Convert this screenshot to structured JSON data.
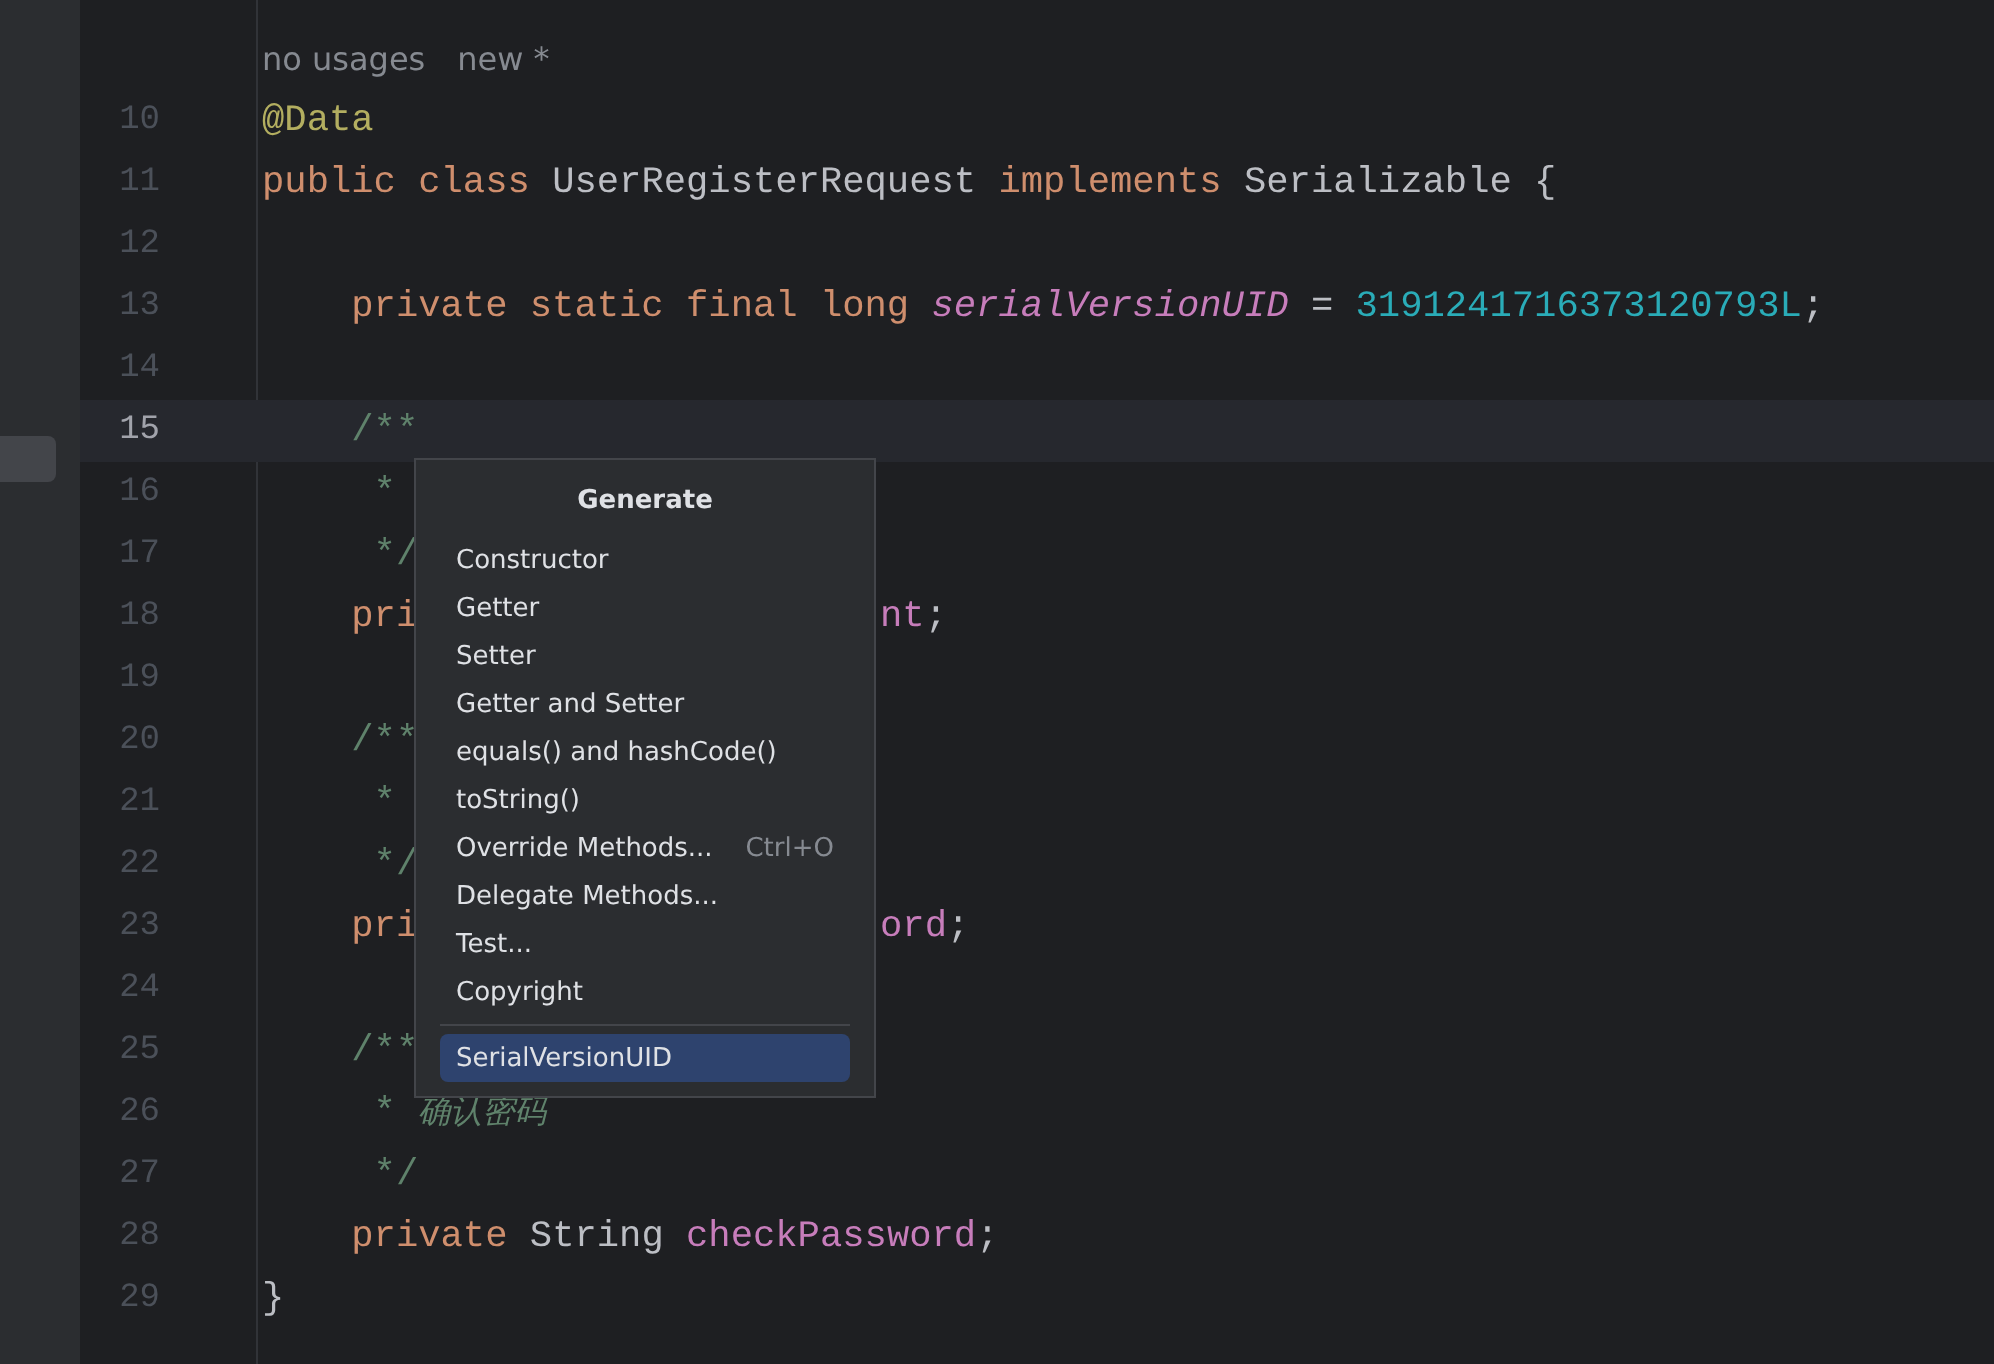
{
  "editor": {
    "lines": [
      {
        "kind": "blank"
      },
      {
        "kind": "hint",
        "texts": [
          "no usages",
          "new *"
        ]
      },
      {
        "kind": "code",
        "number": "10",
        "current": false,
        "tokens": [
          {
            "text": "@Data",
            "kind": "annotation"
          }
        ]
      },
      {
        "kind": "code",
        "number": "11",
        "current": false,
        "tokens": [
          {
            "text": "public class ",
            "kind": "keyword"
          },
          {
            "text": "UserRegisterRequest ",
            "kind": "plain"
          },
          {
            "text": "implements ",
            "kind": "keyword"
          },
          {
            "text": "Serializable {",
            "kind": "plain"
          }
        ]
      },
      {
        "kind": "code",
        "number": "12",
        "current": false
      },
      {
        "kind": "code",
        "number": "13",
        "current": false,
        "tokens": [
          {
            "text": "    private static final long ",
            "kind": "keyword"
          },
          {
            "text": "serialVersionUID",
            "kind": "static_field"
          },
          {
            "text": " = ",
            "kind": "plain"
          },
          {
            "text": "3191241716373120793L",
            "kind": "number"
          },
          {
            "text": ";",
            "kind": "plain"
          }
        ]
      },
      {
        "kind": "code",
        "number": "14",
        "current": false
      },
      {
        "kind": "code",
        "number": "15",
        "current": true,
        "tokens": [
          {
            "text": "    /**",
            "kind": "doc_comment"
          }
        ]
      },
      {
        "kind": "code",
        "number": "16",
        "current": false,
        "tokens": [
          {
            "text": "     *",
            "kind": "doc_comment"
          }
        ]
      },
      {
        "kind": "code",
        "number": "17",
        "current": false,
        "tokens": [
          {
            "text": "     */",
            "kind": "doc_comment"
          }
        ]
      },
      {
        "kind": "code",
        "number": "18",
        "current": false,
        "tokens": [
          {
            "text": "    pri",
            "kind": "keyword"
          }
        ],
        "right_tokens": [
          {
            "text": "nt",
            "kind": "field"
          },
          {
            "text": ";",
            "kind": "plain"
          }
        ]
      },
      {
        "kind": "code",
        "number": "19",
        "current": false
      },
      {
        "kind": "code",
        "number": "20",
        "current": false,
        "tokens": [
          {
            "text": "    /**",
            "kind": "doc_comment"
          }
        ]
      },
      {
        "kind": "code",
        "number": "21",
        "current": false,
        "tokens": [
          {
            "text": "     *",
            "kind": "doc_comment"
          }
        ]
      },
      {
        "kind": "code",
        "number": "22",
        "current": false,
        "tokens": [
          {
            "text": "     */",
            "kind": "doc_comment"
          }
        ]
      },
      {
        "kind": "code",
        "number": "23",
        "current": false,
        "tokens": [
          {
            "text": "    pri",
            "kind": "keyword"
          }
        ],
        "right_tokens": [
          {
            "text": "ord",
            "kind": "field"
          },
          {
            "text": ";",
            "kind": "plain"
          }
        ]
      },
      {
        "kind": "code",
        "number": "24",
        "current": false
      },
      {
        "kind": "code",
        "number": "25",
        "current": false,
        "tokens": [
          {
            "text": "    /**",
            "kind": "doc_comment"
          }
        ]
      },
      {
        "kind": "code",
        "number": "26",
        "current": false,
        "tokens": [
          {
            "text": "     * ",
            "kind": "doc_comment"
          },
          {
            "text": "确认密码",
            "kind": "doc_comment_text"
          }
        ]
      },
      {
        "kind": "code",
        "number": "27",
        "current": false,
        "tokens": [
          {
            "text": "     */",
            "kind": "doc_comment"
          }
        ]
      },
      {
        "kind": "code",
        "number": "28",
        "current": false,
        "tokens": [
          {
            "text": "    private ",
            "kind": "keyword"
          },
          {
            "text": "String ",
            "kind": "plain"
          },
          {
            "text": "checkPassword",
            "kind": "field"
          },
          {
            "text": ";",
            "kind": "plain"
          }
        ]
      },
      {
        "kind": "code",
        "number": "29",
        "current": false,
        "tokens": [
          {
            "text": "}",
            "kind": "plain"
          }
        ]
      }
    ]
  },
  "popup": {
    "title": "Generate",
    "items": [
      {
        "label": "Constructor",
        "selected": false
      },
      {
        "label": "Getter",
        "selected": false
      },
      {
        "label": "Setter",
        "selected": false
      },
      {
        "label": "Getter and Setter",
        "selected": false
      },
      {
        "label": "equals() and hashCode()",
        "selected": false
      },
      {
        "label": "toString()",
        "selected": false
      },
      {
        "label": "Override Methods...",
        "shortcut": "Ctrl+O",
        "selected": false
      },
      {
        "label": "Delegate Methods...",
        "selected": false
      },
      {
        "label": "Test...",
        "selected": false
      },
      {
        "label": "Copyright",
        "selected": false
      },
      {
        "label": "SerialVersionUID",
        "selected": true,
        "separator_before": true
      }
    ]
  }
}
